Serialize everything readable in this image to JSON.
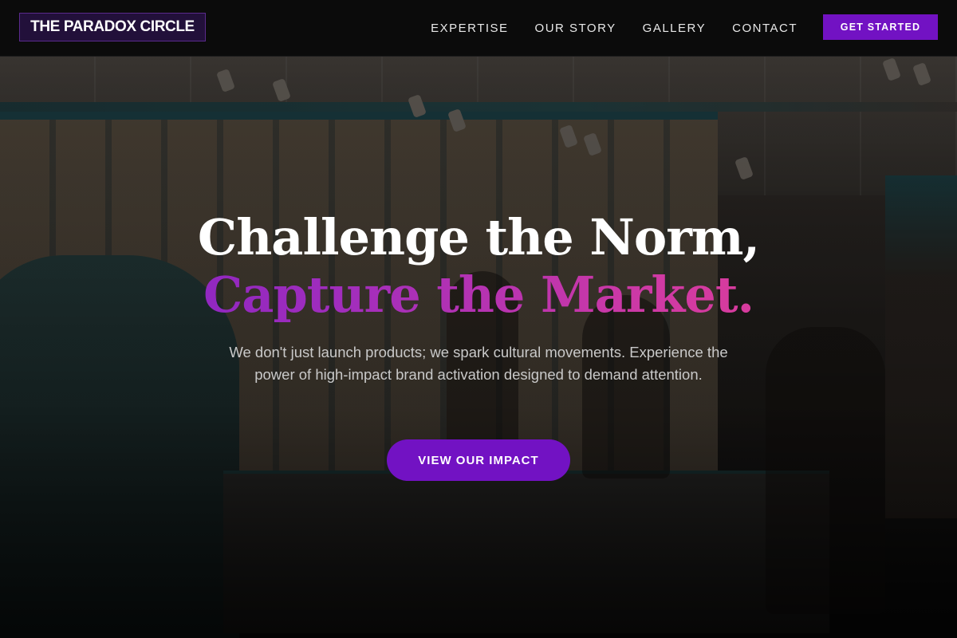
{
  "nav": {
    "logo": "THE PARADOX CIRCLE",
    "links": [
      "EXPERTISE",
      "OUR STORY",
      "GALLERY",
      "CONTACT"
    ],
    "cta": "GET STARTED"
  },
  "hero": {
    "headline_line1": "Challenge the Norm,",
    "headline_line2": "Capture the Market.",
    "subtext": "We don't just launch products; we spark cultural movements. Experience the power of high-impact brand activation designed to demand attention.",
    "cta": "VIEW OUR IMPACT"
  },
  "colors": {
    "accent": "#7212c3",
    "gradient_start": "#7a1fc4",
    "gradient_end": "#e63e8e",
    "nav_bg": "#0b0b0b"
  }
}
